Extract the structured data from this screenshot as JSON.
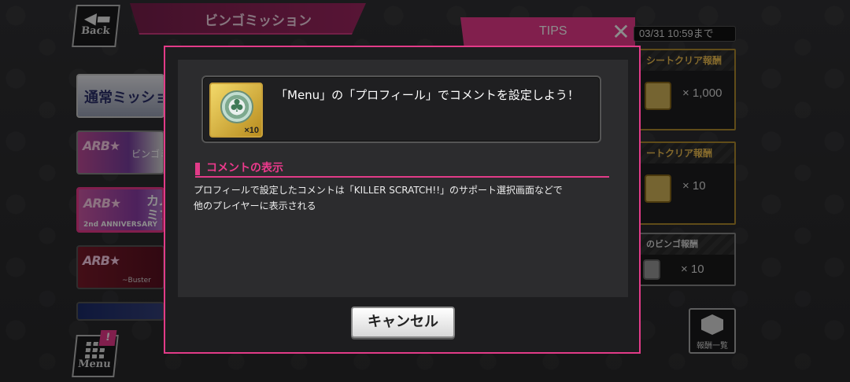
{
  "header": {
    "back_label": "Back",
    "title": "ビンゴミッション",
    "tips_tab": "TIPS",
    "deadline": "03/31 10:59まで"
  },
  "missions": {
    "normal": "通常ミッション",
    "bingo": "ビンゴミ",
    "anniversary_subtitle": "2nd ANNIVERSARY",
    "anniversary_title": "カム\nミプ",
    "buster": "~Buster"
  },
  "rewards": {
    "sheet_clear_1": {
      "title": "シートクリア報酬",
      "qty": "× 1,000"
    },
    "sheet_clear_2": {
      "title": "ートクリア報酬",
      "qty": "× 10"
    },
    "bingo": {
      "title": "のビンゴ報酬",
      "qty": "× 10"
    },
    "list_label": "報酬一覧"
  },
  "menu": {
    "label": "Menu",
    "badge": "!"
  },
  "dialog": {
    "tip_text": "「Menu」の「プロフィール」でコメントを設定しよう！",
    "item_qty": "×10",
    "section_title": "コメントの表示",
    "section_body_line1": "プロフィールで設定したコメントは「KILLER SCRATCH!!」のサポート選択画面などで",
    "section_body_line2": "他のプレイヤーに表示される",
    "cancel_label": "キャンセル"
  },
  "colors": {
    "accent": "#e23b88",
    "gold": "#b08a2e"
  },
  "icons": {
    "close": "close-icon",
    "back": "back-arrow-icon",
    "menu": "grid-icon",
    "rewards": "box-icon",
    "item": "clover-badge-icon"
  }
}
